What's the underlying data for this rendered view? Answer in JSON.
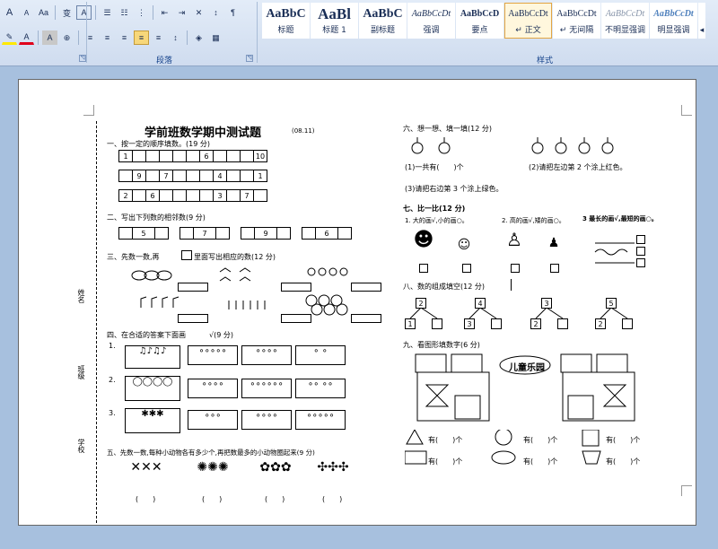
{
  "ribbon": {
    "font_group_label": "段落",
    "styles_group_label": "样式",
    "launcher_glyph": "◹",
    "styles": [
      {
        "preview": "AaBbC",
        "name": "标题"
      },
      {
        "preview": "AaBl",
        "name": "标题 1"
      },
      {
        "preview": "AaBbC",
        "name": "副标题"
      },
      {
        "preview": "AaBbCcDt",
        "name": "强调"
      },
      {
        "preview": "AaBbCcD",
        "name": "要点"
      },
      {
        "preview": "AaBbCcDt",
        "name": "↵ 正文"
      },
      {
        "preview": "AaBbCcDt",
        "name": "↵ 无间隔"
      },
      {
        "preview": "AaBbCcDt",
        "name": "不明显强调"
      },
      {
        "preview": "AaBbCcDt",
        "name": "明显强调"
      },
      {
        "preview": "",
        "name": "◂"
      }
    ],
    "toolbar_glyphs": {
      "grow": "A",
      "shrink": "A",
      "case": "Aa",
      "phonetic": "变",
      "border": "A",
      "bullets": "☰",
      "numbering": "☷",
      "multilevel": "⋮",
      "dec_indent": "⇤",
      "inc_indent": "⇥",
      "chinese_layout": "✕",
      "sort": "↕",
      "show_marks": "¶",
      "highlight": "✎",
      "font_color": "A",
      "char_shade": "A",
      "enclose": "⊕",
      "align_left": "≡",
      "center": "≡",
      "align_right": "≡",
      "justify": "≡",
      "distributed": "≡",
      "line_spacing": "↕",
      "shading": "◈",
      "borders": "▦"
    }
  },
  "doc": {
    "title": "学前班数学期中测试题",
    "title_note": "(08.11)",
    "s1": "一、按一定的顺序填数。(19 分)",
    "s1_rows": [
      [
        "1",
        "",
        "",
        "",
        "",
        "",
        "6",
        "",
        "",
        "",
        "10"
      ],
      [
        "",
        "9",
        "",
        "7",
        "",
        "",
        "",
        "4",
        "",
        "",
        "1"
      ],
      [
        "2",
        "",
        "6",
        "",
        "",
        "",
        "",
        "3",
        "",
        "7",
        ""
      ]
    ],
    "s2": "二、写出下列数的相邻数(9 分)",
    "s2_vals": [
      "5",
      "7",
      "9",
      "6"
    ],
    "s3a": "三、先数一数,再",
    "s3b": "里面写出相应的数(12 分)",
    "s4": "四、在合适的答案下面画",
    "s4b": "√(9 分)",
    "s4_nums": [
      "1.",
      "2.",
      "3."
    ],
    "s5": "五、先数一数,每种小动物各有多少个,再把数最多的小动物圈起来(9 分)",
    "paren": "(　　)",
    "side_labels": [
      "姓名",
      "班级",
      "学校"
    ],
    "s6": "六、想一想、填一填(12 分)",
    "s6_q1a": "(1)一共有(　　)个",
    "s6_q1b": "(2)请把左边第 2 个涂上红色。",
    "s6_q3": "(3)请把右边第 3 个涂上绿色。",
    "s7": "七、比一比(12 分)",
    "s7_q1": "1. 大的画√,小的画○。",
    "s7_q2": "2. 高的画√,矮的画○。",
    "s7_q3": "3 最长的画√,最短的画○。",
    "s8": "八、数的组成填空(12 分)",
    "s8_tops": [
      "2",
      "4",
      "3",
      "5"
    ],
    "s8_lefts": [
      "1",
      "3",
      "2",
      "2"
    ],
    "s9": "九、看图形填数字(6 分)",
    "castle_sign": "儿童乐园",
    "shape_line": "有(　　)个",
    "math_glyphs": {
      "figure": "♣",
      "marks": "○ ○",
      "animal": "✱"
    }
  }
}
